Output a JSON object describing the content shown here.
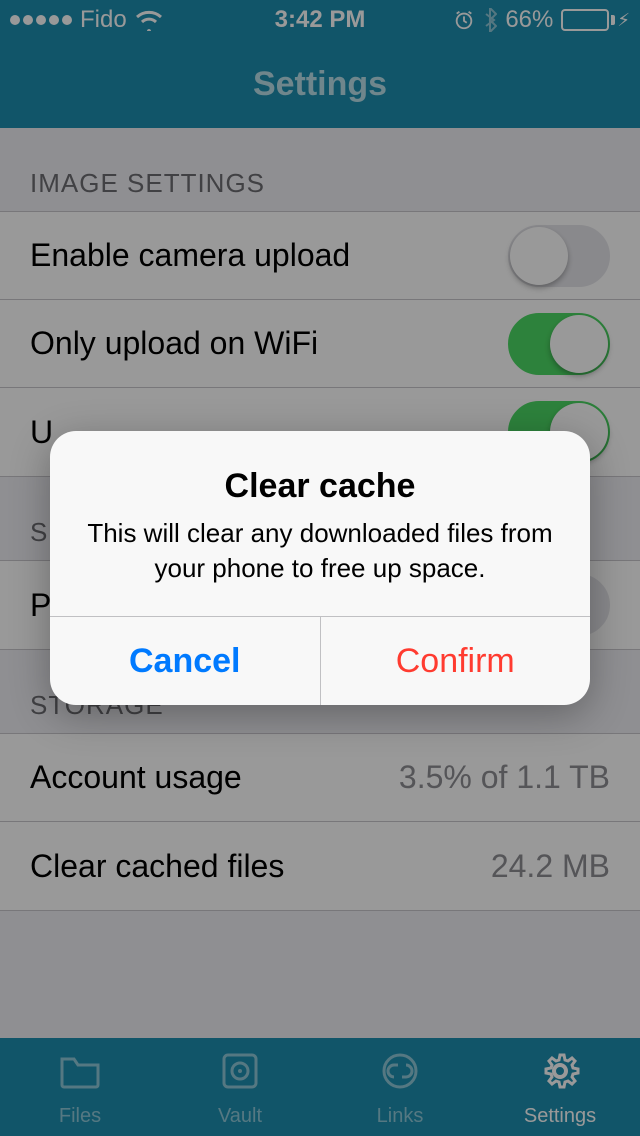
{
  "status": {
    "carrier": "Fido",
    "time": "3:42 PM",
    "battery_pct": "66%"
  },
  "nav": {
    "title": "Settings"
  },
  "sections": {
    "image": {
      "header": "IMAGE SETTINGS",
      "rows": {
        "camera_upload": {
          "label": "Enable camera upload",
          "on": false
        },
        "wifi_only": {
          "label": "Only upload on WiFi",
          "on": true
        },
        "third": {
          "label": "U",
          "on": true
        }
      }
    },
    "second": {
      "header": "S",
      "rows": {
        "p": {
          "label": "P",
          "on": false
        }
      }
    },
    "storage": {
      "header": "STORAGE",
      "rows": {
        "usage": {
          "label": "Account usage",
          "value": "3.5% of  1.1 TB"
        },
        "cache": {
          "label": "Clear cached files",
          "value": "24.2 MB"
        }
      }
    }
  },
  "tabs": {
    "files": "Files",
    "vault": "Vault",
    "links": "Links",
    "settings": "Settings"
  },
  "alert": {
    "title": "Clear cache",
    "message": "This will clear any downloaded files from your phone to free up space.",
    "cancel": "Cancel",
    "confirm": "Confirm"
  }
}
